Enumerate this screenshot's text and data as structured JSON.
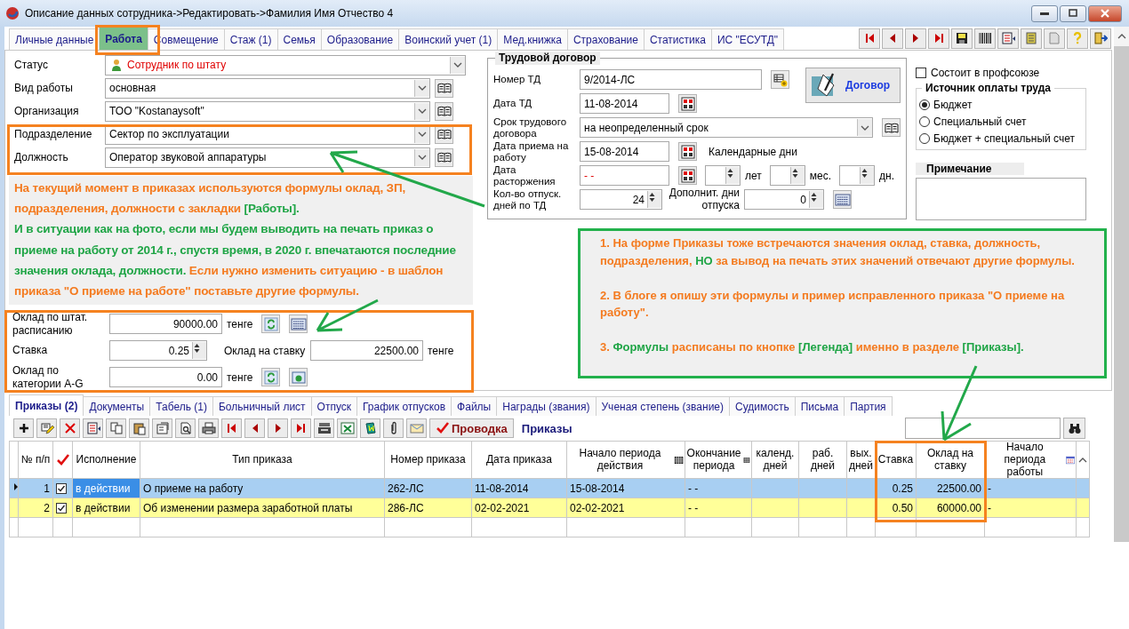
{
  "window": {
    "title": "Описание данных сотрудника->Редактировать->Фамилия Имя Отчество 4"
  },
  "top_tabs": [
    {
      "label": "Личные данные",
      "selected": false
    },
    {
      "label": "Работа",
      "selected": true
    },
    {
      "label": "Совмещение",
      "selected": false
    },
    {
      "label": "Стаж (1)",
      "selected": false
    },
    {
      "label": "Семья",
      "selected": false
    },
    {
      "label": "Образование",
      "selected": false
    },
    {
      "label": "Воинский учет (1)",
      "selected": false
    },
    {
      "label": "Мед.книжка",
      "selected": false
    },
    {
      "label": "Страхование",
      "selected": false
    },
    {
      "label": "Статистика",
      "selected": false
    },
    {
      "label": "ИС \"ЕСУТД\"",
      "selected": false
    }
  ],
  "work_fields": [
    {
      "label": "Статус",
      "value": "Сотрудник по штату",
      "kind": "status"
    },
    {
      "label": "Вид работы",
      "value": "основная",
      "kind": "combo"
    },
    {
      "label": "Организация",
      "value": "ТОО \"Kostanaysoft\"",
      "kind": "combo"
    },
    {
      "label": "Подразделение",
      "value": "Сектор по эксплуатации",
      "kind": "combo"
    },
    {
      "label": "Должность",
      "value": "Оператор звуковой аппаратуры",
      "kind": "combo"
    }
  ],
  "left_note": {
    "paragraphs": [
      [
        {
          "text": "На текущий момент в приказах используются формулы оклад, ЗП, подразделения, должности с закладки ",
          "color": "#f47b20"
        },
        {
          "text": "[Работы].",
          "color": "#1fa546"
        }
      ],
      [
        {
          "text": "И в ситуации как на фото, если мы будем выводить на печать приказ о приеме на работу от 2014 г., спустя время, в 2020 г. впечатаются последние значения оклада, должности.",
          "color": "#1fa546"
        },
        {
          "text": " Если нужно изменить ситуацию - в шаблон приказа \"О приеме на работе\" поставьте другие формулы.",
          "color": "#f47b20"
        }
      ]
    ]
  },
  "salary": {
    "staff_salary": {
      "label": "Оклад по штат. расписанию",
      "value": "90000.00",
      "unit": "тенге"
    },
    "rate": {
      "label": "Ставка",
      "value": "0.25"
    },
    "rate_salary": {
      "label": "Оклад на ставку",
      "value": "22500.00",
      "unit": "тенге"
    },
    "category_salary": {
      "label": "Оклад по категории A-G",
      "value": "0.00",
      "unit": "тенге"
    }
  },
  "contract": {
    "title": "Трудовой договор",
    "button": "Договор",
    "rows": [
      {
        "kind": "number",
        "label": "Номер ТД",
        "value": "9/2014-ЛС"
      },
      {
        "kind": "date",
        "label": "Дата ТД",
        "value": "11-08-2014",
        "blank": false
      },
      {
        "kind": "combo",
        "label": "Срок трудового договора",
        "value": "на неопределенный срок"
      },
      {
        "kind": "date",
        "label": "Дата приема на работу",
        "value": "15-08-2014",
        "blank": false,
        "side_label": "Календарные дни"
      },
      {
        "kind": "date",
        "label": "Дата расторжения",
        "value": "- -",
        "blank": true,
        "units": [
          "лет",
          "мес.",
          "дн."
        ]
      },
      {
        "kind": "spin",
        "label": "Кол-во отпуск. дней по ТД",
        "value": "24",
        "side_label": "Дополнит. дни отпуска",
        "side_value": "0"
      }
    ]
  },
  "union_member": {
    "label": "Состоит в профсоюзе",
    "checked": false
  },
  "pay_source": {
    "title": "Источник оплаты труда",
    "options": [
      {
        "label": "Бюджет",
        "selected": true
      },
      {
        "label": "Специальный счет",
        "selected": false
      },
      {
        "label": "Бюджет + специальный счет",
        "selected": false
      }
    ]
  },
  "note": {
    "title": "Примечание"
  },
  "right_note": {
    "paragraphs": [
      [
        {
          "text": "1. На форме Приказы тоже встречаются значения оклад, ставка, должность, подразделения, ",
          "color": "#f47b20"
        },
        {
          "text": "НО",
          "color": "#1fa546"
        },
        {
          "text": " за вывод на печать этих значений отвечают другие формулы.",
          "color": "#f47b20"
        }
      ],
      [
        {
          "text": "2. В блоге я опишу эти формулы и пример исправленного приказа \"О приеме на работу\".",
          "color": "#f47b20"
        }
      ],
      [
        {
          "text": "3. ",
          "color": "#f47b20"
        },
        {
          "text": "Формулы",
          "color": "#1fa546"
        },
        {
          "text": " расписаны по кнопке ",
          "color": "#f47b20"
        },
        {
          "text": "[Легенда]",
          "color": "#1fa546"
        },
        {
          "text": " именно в разделе ",
          "color": "#f47b20"
        },
        {
          "text": "[Приказы].",
          "color": "#1fa546"
        }
      ]
    ]
  },
  "bottom_tabs": [
    {
      "label": "Приказы (2)",
      "selected": true
    },
    {
      "label": "Документы",
      "selected": false
    },
    {
      "label": "Табель (1)",
      "selected": false
    },
    {
      "label": "Больничный лист",
      "selected": false
    },
    {
      "label": "Отпуск",
      "selected": false
    },
    {
      "label": "График отпусков",
      "selected": false
    },
    {
      "label": "Файлы",
      "selected": false
    },
    {
      "label": "Награды (звания)",
      "selected": false
    },
    {
      "label": "Ученая степень (звание)",
      "selected": false
    },
    {
      "label": "Судимость",
      "selected": false
    },
    {
      "label": "Письма",
      "selected": false
    },
    {
      "label": "Партия",
      "selected": false
    }
  ],
  "orders_toolbar": {
    "post_button": "Проводка",
    "caption": "Приказы"
  },
  "orders_table": {
    "columns": [
      {
        "label": "№ п/п",
        "kind": "numeric"
      },
      {
        "kind": "check"
      },
      {
        "label": "Исполнение",
        "kind": "plain"
      },
      {
        "label": "Тип приказа",
        "kind": "plain"
      },
      {
        "label": "Номер приказа",
        "kind": "plain"
      },
      {
        "label": "Дата приказа",
        "kind": "plain"
      },
      {
        "label": "Начало периода действия",
        "kind": "grid"
      },
      {
        "label": "Окончание периода",
        "kind": "grid"
      },
      {
        "label": "календ. дней",
        "kind": "plain"
      },
      {
        "label": "раб. дней",
        "kind": "plain"
      },
      {
        "label": "вых. дней",
        "kind": "plain"
      },
      {
        "label": "Ставка",
        "kind": "numeric"
      },
      {
        "label": "Оклад на ставку",
        "kind": "numeric"
      },
      {
        "label": "Начало периода работы",
        "kind": "calendar"
      }
    ],
    "rows": [
      {
        "selected": true,
        "highlighted": false,
        "checked": true,
        "cells": [
          "1",
          null,
          "в действии",
          "О приеме на работу",
          "262-ЛС",
          "11-08-2014",
          "15-08-2014",
          "- -",
          null,
          null,
          null,
          "0.25",
          "22500.00",
          "-"
        ]
      },
      {
        "selected": false,
        "highlighted": true,
        "checked": true,
        "cells": [
          "2",
          null,
          "в действии",
          "Об изменении размера заработной платы",
          "286-ЛС",
          "02-02-2021",
          "02-02-2021",
          "- -",
          null,
          null,
          null,
          "0.50",
          "60000.00",
          "-"
        ]
      }
    ]
  }
}
